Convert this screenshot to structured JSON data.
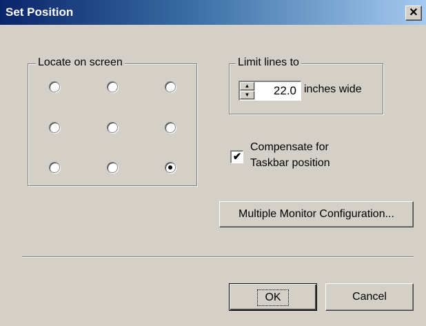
{
  "window": {
    "title": "Set Position",
    "close_label": "✕"
  },
  "locate": {
    "label": "Locate on screen",
    "grid": [
      [
        false,
        false,
        false
      ],
      [
        false,
        false,
        false
      ],
      [
        false,
        false,
        true
      ]
    ]
  },
  "limit": {
    "label": "Limit lines to",
    "value": "22.0",
    "suffix": "inches wide"
  },
  "compensate": {
    "checked": true,
    "check_mark": "✔",
    "line1": "Compensate for",
    "line2": "Taskbar position"
  },
  "buttons": {
    "monitor": "Multiple Monitor Configuration...",
    "ok": "OK",
    "cancel": "Cancel"
  }
}
